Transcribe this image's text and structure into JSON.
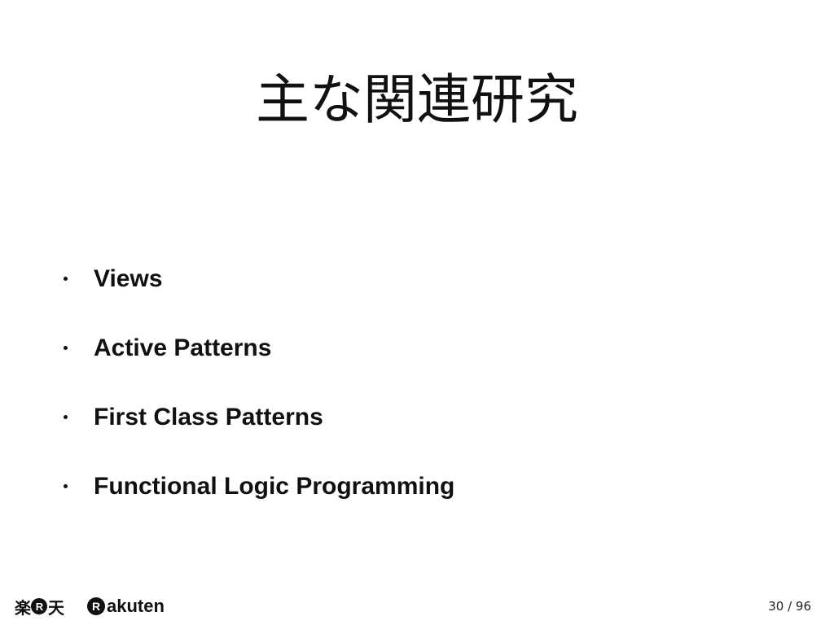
{
  "slide": {
    "title": "主な関連研究",
    "bullets": [
      "Views",
      "Active Patterns",
      "First Class Patterns",
      "Functional Logic Programming"
    ]
  },
  "footer": {
    "logo_kanji_1": "楽",
    "logo_r": "R",
    "logo_kanji_2": "天",
    "wordmark": "akuten",
    "page_number": "30 / 96"
  }
}
